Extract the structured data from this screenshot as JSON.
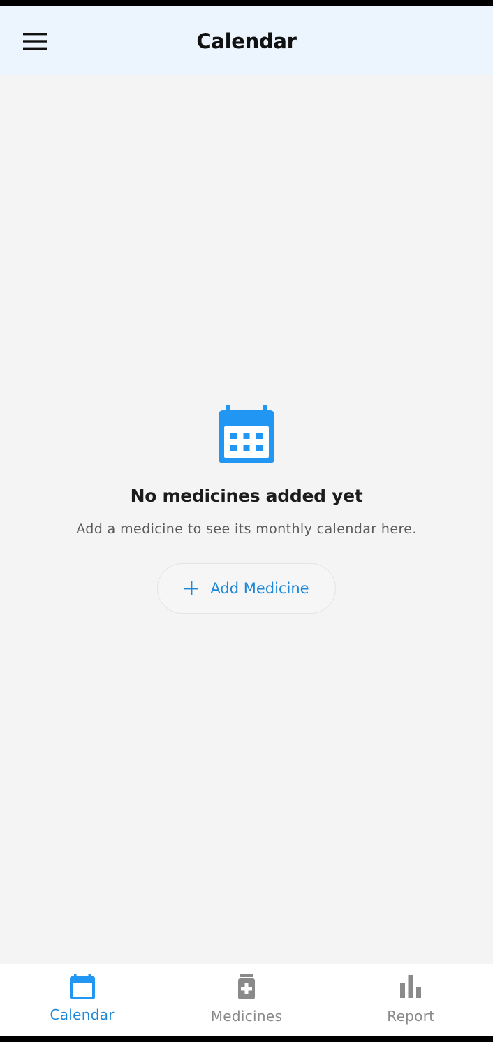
{
  "app_bar": {
    "title": "Calendar",
    "menu_icon": "hamburger-menu-icon"
  },
  "empty_state": {
    "icon": "calendar-icon",
    "title": "No medicines added yet",
    "subtitle": "Add a medicine to see its monthly calendar here.",
    "button": {
      "icon": "plus-icon",
      "label": "Add Medicine"
    }
  },
  "bottom_nav": {
    "items": [
      {
        "label": "Calendar",
        "icon": "calendar-icon",
        "active": true
      },
      {
        "label": "Medicines",
        "icon": "medicine-bottle-icon",
        "active": false
      },
      {
        "label": "Report",
        "icon": "bar-chart-icon",
        "active": false
      }
    ]
  },
  "colors": {
    "accent": "#1e88d8",
    "icon_blue": "#2196f3",
    "app_bar_bg": "#ecf5fe",
    "background": "#f4f4f4",
    "inactive": "#8a8a8a"
  }
}
